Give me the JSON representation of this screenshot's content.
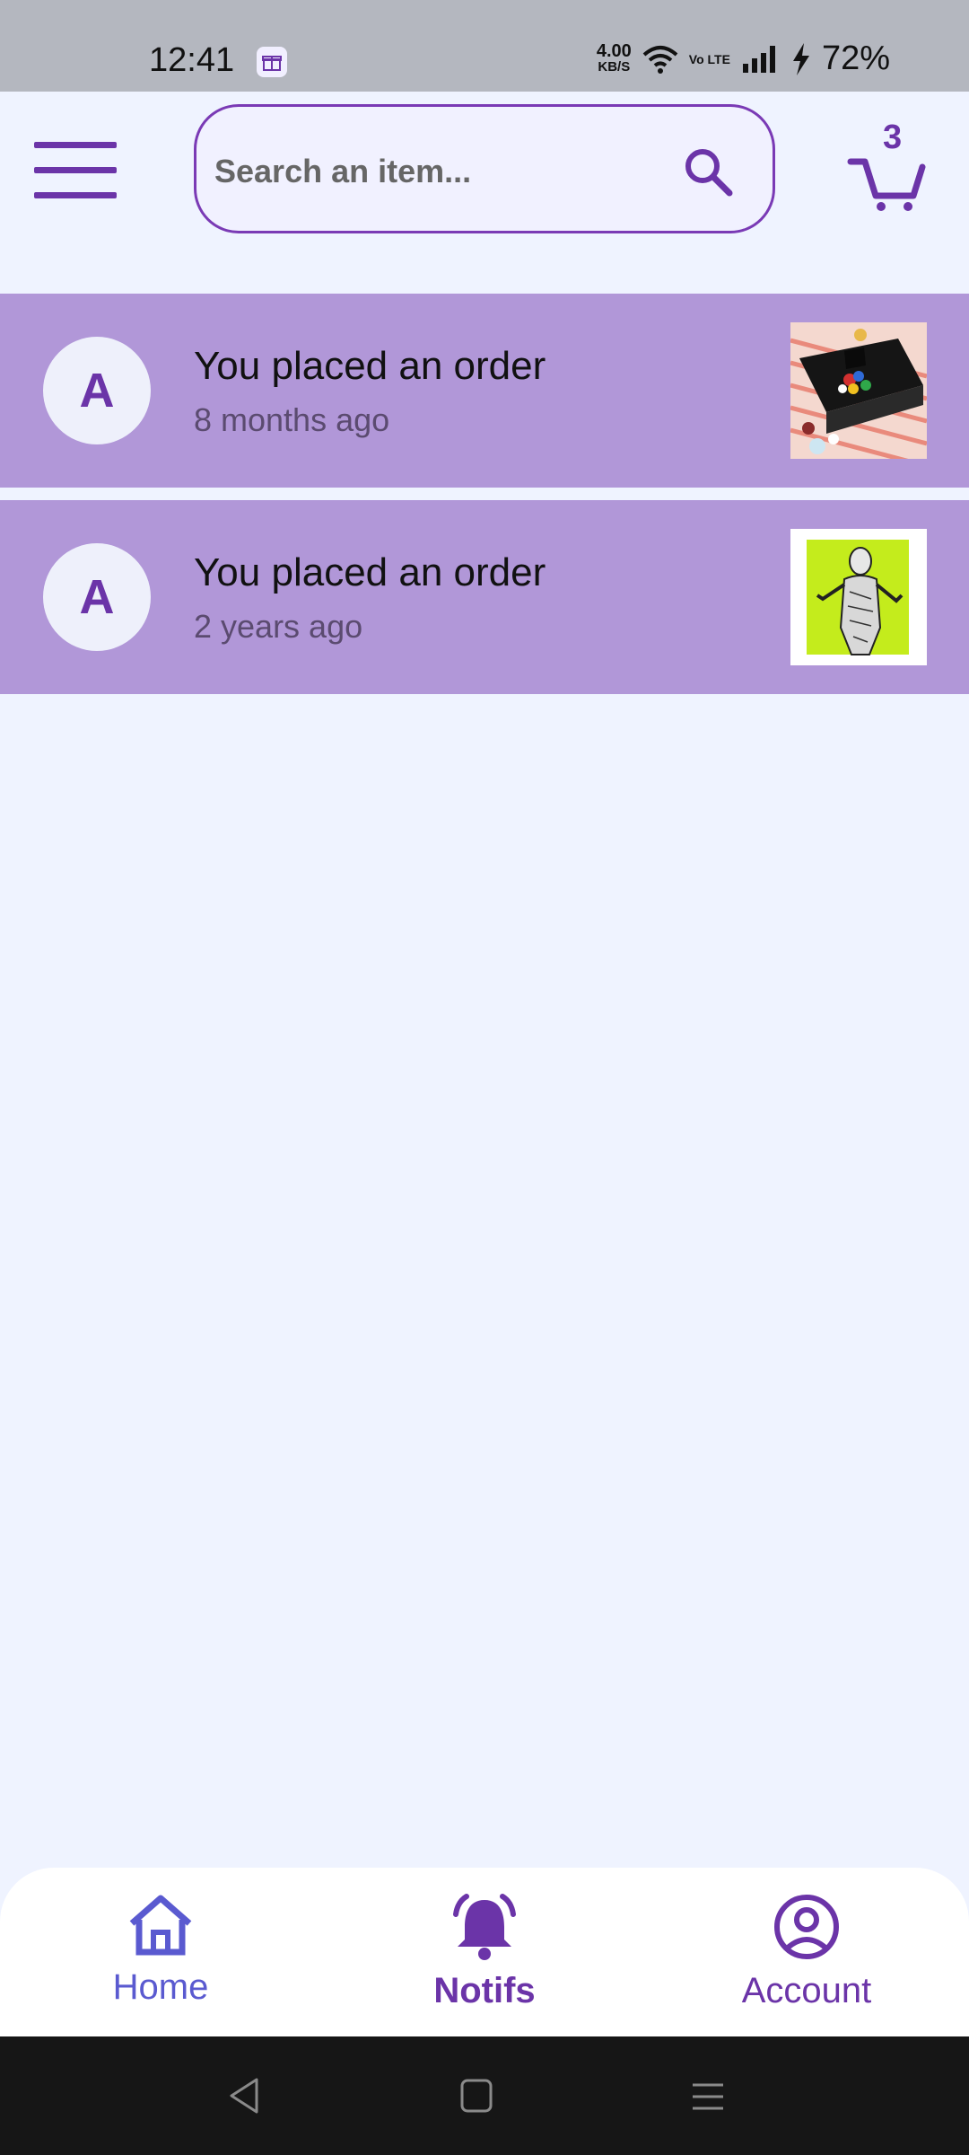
{
  "status_bar": {
    "time": "12:41",
    "net_speed": "4.00",
    "net_unit": "KB/S",
    "volte": "Vo LTE",
    "battery": "72%"
  },
  "header": {
    "search_placeholder": "Search an item...",
    "cart_count": "3"
  },
  "notifications": [
    {
      "avatar": "A",
      "title": "You placed an order",
      "time": "8 months ago"
    },
    {
      "avatar": "A",
      "title": "You placed an order",
      "time": "2 years ago"
    }
  ],
  "bottom_nav": {
    "home": "Home",
    "notifs": "Notifs",
    "account": "Account"
  },
  "colors": {
    "accent": "#6b34a8",
    "row_bg": "#b197d8",
    "page_bg": "#eff3ff"
  }
}
